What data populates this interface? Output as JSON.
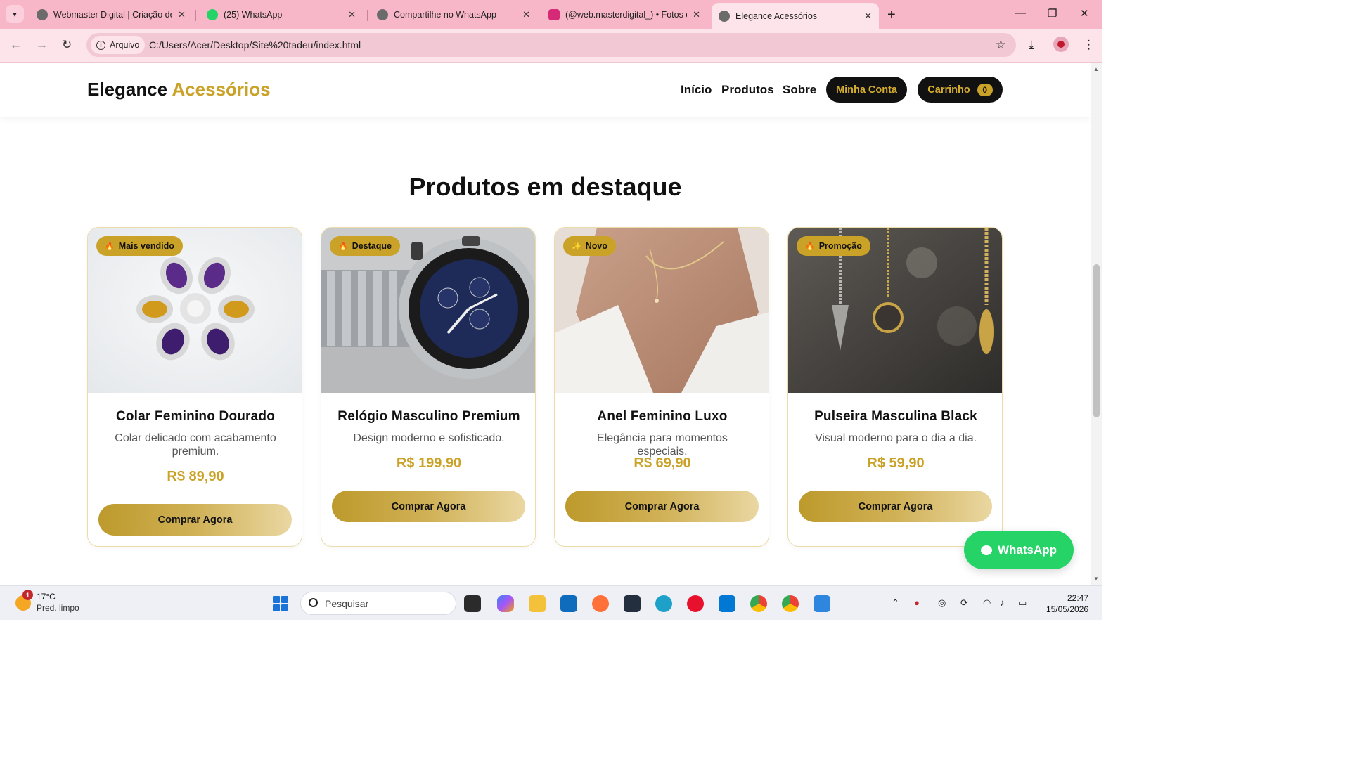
{
  "browser": {
    "tabs": [
      {
        "title": "Webmaster Digital | Criação de",
        "fav_color": "#6b6b6b",
        "active": false
      },
      {
        "title": "(25) WhatsApp",
        "fav_color": "#25d366",
        "active": false
      },
      {
        "title": "Compartilhe no WhatsApp",
        "fav_color": "#6b6b6b",
        "active": false
      },
      {
        "title": "(@web.masterdigital_) • Fotos e",
        "fav_color": "#d62976",
        "active": false
      },
      {
        "title": "Elegance Acessórios",
        "fav_color": "#6b6b6b",
        "active": true
      }
    ],
    "new_tab": "+",
    "window_controls": {
      "minimize": "—",
      "restore": "❐",
      "close": "✕"
    },
    "chip_label": "Arquivo",
    "url": "C:/Users/Acer/Desktop/Site%20tadeu/index.html"
  },
  "site": {
    "logo_part1": "Elegance",
    "logo_part2": "Acessórios",
    "nav": [
      "Início",
      "Produtos",
      "Sobre"
    ],
    "account_button": "Minha Conta",
    "cart_button": "Carrinho",
    "cart_count": "0",
    "section_title": "Produtos em destaque",
    "products": [
      {
        "tag": "Mais vendido",
        "name": "Colar Feminino Dourado",
        "desc": "Colar delicado com acabamento premium.",
        "price": "R$ 89,90",
        "button": "Comprar Agora"
      },
      {
        "tag": "Destaque",
        "name": "Relógio Masculino Premium",
        "desc": "Design moderno e sofisticado.",
        "price": "R$ 199,90",
        "button": "Comprar Agora"
      },
      {
        "tag": "Novo",
        "name": "Anel Feminino Luxo",
        "desc": "Elegância para momentos especiais.",
        "price": "R$ 69,90",
        "button": "Comprar Agora"
      },
      {
        "tag": "Promoção",
        "name": "Pulseira Masculina Black",
        "desc": "Visual moderno para o dia a dia.",
        "price": "R$ 59,90",
        "button": "Comprar Agora"
      }
    ],
    "whatsapp_button": "WhatsApp",
    "accent_color": "#c9a227"
  },
  "taskbar": {
    "weather_temp": "17°C",
    "weather_desc": "Pred. limpo",
    "weather_badge": "1",
    "search_placeholder": "Pesquisar",
    "time": "22:47",
    "date": "15/05/2026"
  }
}
